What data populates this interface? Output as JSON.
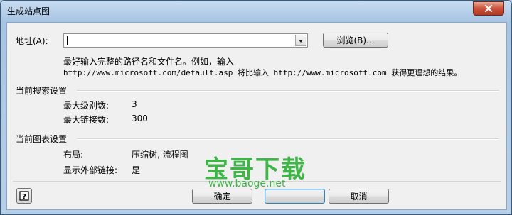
{
  "window": {
    "title": "生成站点图"
  },
  "address": {
    "label": "地址(A):",
    "value": "",
    "browse_label": "浏览(B)..."
  },
  "hint": {
    "line1": "最好输入完整的路径名和文件名。例如，输入",
    "line2": "http://www.microsoft.com/default.asp 将比输入 http://www.microsoft.com 获得更理想的结果。"
  },
  "search_settings": {
    "heading": "当前搜索设置",
    "rows": [
      {
        "label": "最大级别数:",
        "value": "3"
      },
      {
        "label": "最大链接数:",
        "value": "300"
      }
    ]
  },
  "chart_settings": {
    "heading": "当前图表设置",
    "rows": [
      {
        "label": "布局:",
        "value": "压缩树, 流程图"
      },
      {
        "label": "显示外部链接:",
        "value": "是"
      }
    ]
  },
  "footer": {
    "ok_label": "确定",
    "cancel_label": "取消"
  },
  "watermark": {
    "brand": "宝哥下载",
    "url": "www.baoge.net"
  },
  "colors": {
    "accent_border": "#3c7fb1",
    "close_button": "#c9503a",
    "watermark": "#3fb548"
  }
}
